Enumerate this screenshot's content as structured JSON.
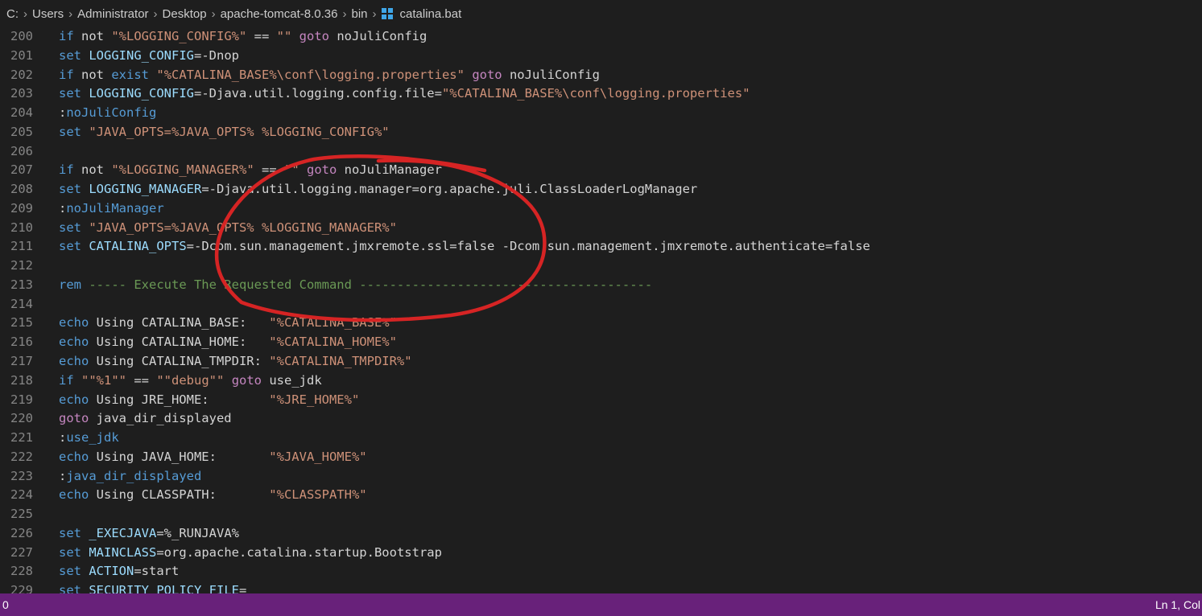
{
  "breadcrumb": {
    "items": [
      "C:",
      "Users",
      "Administrator",
      "Desktop",
      "apache-tomcat-8.0.36",
      "bin"
    ],
    "file": "catalina.bat",
    "file_icon": "windows-file-icon"
  },
  "colors": {
    "background": "#1e1e1e",
    "status_bar": "#68217a",
    "annotation": "#d62424"
  },
  "editor": {
    "lines": [
      {
        "num": "200",
        "tokens": [
          [
            "kw",
            "if"
          ],
          [
            "txt",
            " not "
          ],
          [
            "str",
            "\"%LOGGING_CONFIG%\""
          ],
          [
            "txt",
            " == "
          ],
          [
            "str",
            "\"\""
          ],
          [
            "txt",
            " "
          ],
          [
            "ctl",
            "goto"
          ],
          [
            "txt",
            " noJuliConfig"
          ]
        ]
      },
      {
        "num": "201",
        "tokens": [
          [
            "kw",
            "set"
          ],
          [
            "txt",
            " "
          ],
          [
            "var",
            "LOGGING_CONFIG"
          ],
          [
            "txt",
            "=-Dnop"
          ]
        ]
      },
      {
        "num": "202",
        "tokens": [
          [
            "kw",
            "if"
          ],
          [
            "txt",
            " not "
          ],
          [
            "kw",
            "exist"
          ],
          [
            "txt",
            " "
          ],
          [
            "str",
            "\"%CATALINA_BASE%\\conf\\logging.properties\""
          ],
          [
            "txt",
            " "
          ],
          [
            "ctl",
            "goto"
          ],
          [
            "txt",
            " noJuliConfig"
          ]
        ]
      },
      {
        "num": "203",
        "tokens": [
          [
            "kw",
            "set"
          ],
          [
            "txt",
            " "
          ],
          [
            "var",
            "LOGGING_CONFIG"
          ],
          [
            "txt",
            "=-Djava.util.logging.config.file="
          ],
          [
            "str",
            "\"%CATALINA_BASE%\\conf\\logging.properties\""
          ]
        ]
      },
      {
        "num": "204",
        "tokens": [
          [
            "txt",
            ":"
          ],
          [
            "lbl",
            "noJuliConfig"
          ]
        ]
      },
      {
        "num": "205",
        "tokens": [
          [
            "kw",
            "set"
          ],
          [
            "txt",
            " "
          ],
          [
            "str",
            "\"JAVA_OPTS=%JAVA_OPTS% %LOGGING_CONFIG%\""
          ]
        ]
      },
      {
        "num": "206",
        "tokens": []
      },
      {
        "num": "207",
        "tokens": [
          [
            "kw",
            "if"
          ],
          [
            "txt",
            " not "
          ],
          [
            "str",
            "\"%LOGGING_MANAGER%\""
          ],
          [
            "txt",
            " == "
          ],
          [
            "str",
            "\"\""
          ],
          [
            "txt",
            " "
          ],
          [
            "ctl",
            "goto"
          ],
          [
            "txt",
            " noJuliManager"
          ]
        ]
      },
      {
        "num": "208",
        "tokens": [
          [
            "kw",
            "set"
          ],
          [
            "txt",
            " "
          ],
          [
            "var",
            "LOGGING_MANAGER"
          ],
          [
            "txt",
            "=-Djava.util.logging.manager=org.apache.juli.ClassLoaderLogManager"
          ]
        ]
      },
      {
        "num": "209",
        "tokens": [
          [
            "txt",
            ":"
          ],
          [
            "lbl",
            "noJuliManager"
          ]
        ]
      },
      {
        "num": "210",
        "tokens": [
          [
            "kw",
            "set"
          ],
          [
            "txt",
            " "
          ],
          [
            "str",
            "\"JAVA_OPTS=%JAVA_OPTS% %LOGGING_MANAGER%\""
          ]
        ]
      },
      {
        "num": "211",
        "tokens": [
          [
            "kw",
            "set"
          ],
          [
            "txt",
            " "
          ],
          [
            "var",
            "CATALINA_OPTS"
          ],
          [
            "txt",
            "=-Dcom.sun.management.jmxremote.ssl=false -Dcom.sun.management.jmxremote.authenticate=false"
          ]
        ]
      },
      {
        "num": "212",
        "tokens": []
      },
      {
        "num": "213",
        "tokens": [
          [
            "kw",
            "rem"
          ],
          [
            "cmt",
            " ----- Execute The Requested Command ---------------------------------------"
          ]
        ]
      },
      {
        "num": "214",
        "tokens": []
      },
      {
        "num": "215",
        "tokens": [
          [
            "kw",
            "echo"
          ],
          [
            "txt",
            " Using CATALINA_BASE:   "
          ],
          [
            "str",
            "\"%CATALINA_BASE%\""
          ]
        ]
      },
      {
        "num": "216",
        "tokens": [
          [
            "kw",
            "echo"
          ],
          [
            "txt",
            " Using CATALINA_HOME:   "
          ],
          [
            "str",
            "\"%CATALINA_HOME%\""
          ]
        ]
      },
      {
        "num": "217",
        "tokens": [
          [
            "kw",
            "echo"
          ],
          [
            "txt",
            " Using CATALINA_TMPDIR: "
          ],
          [
            "str",
            "\"%CATALINA_TMPDIR%\""
          ]
        ]
      },
      {
        "num": "218",
        "tokens": [
          [
            "kw",
            "if"
          ],
          [
            "txt",
            " "
          ],
          [
            "str",
            "\"\"%1\"\""
          ],
          [
            "txt",
            " == "
          ],
          [
            "str",
            "\"\"debug\"\""
          ],
          [
            "txt",
            " "
          ],
          [
            "ctl",
            "goto"
          ],
          [
            "txt",
            " use_jdk"
          ]
        ]
      },
      {
        "num": "219",
        "tokens": [
          [
            "kw",
            "echo"
          ],
          [
            "txt",
            " Using JRE_HOME:        "
          ],
          [
            "str",
            "\"%JRE_HOME%\""
          ]
        ]
      },
      {
        "num": "220",
        "tokens": [
          [
            "ctl",
            "goto"
          ],
          [
            "txt",
            " java_dir_displayed"
          ]
        ]
      },
      {
        "num": "221",
        "tokens": [
          [
            "txt",
            ":"
          ],
          [
            "lbl",
            "use_jdk"
          ]
        ]
      },
      {
        "num": "222",
        "tokens": [
          [
            "kw",
            "echo"
          ],
          [
            "txt",
            " Using JAVA_HOME:       "
          ],
          [
            "str",
            "\"%JAVA_HOME%\""
          ]
        ]
      },
      {
        "num": "223",
        "tokens": [
          [
            "txt",
            ":"
          ],
          [
            "lbl",
            "java_dir_displayed"
          ]
        ]
      },
      {
        "num": "224",
        "tokens": [
          [
            "kw",
            "echo"
          ],
          [
            "txt",
            " Using CLASSPATH:       "
          ],
          [
            "str",
            "\"%CLASSPATH%\""
          ]
        ]
      },
      {
        "num": "225",
        "tokens": []
      },
      {
        "num": "226",
        "tokens": [
          [
            "kw",
            "set"
          ],
          [
            "txt",
            " "
          ],
          [
            "var",
            "_EXECJAVA"
          ],
          [
            "txt",
            "=%_RUNJAVA%"
          ]
        ]
      },
      {
        "num": "227",
        "tokens": [
          [
            "kw",
            "set"
          ],
          [
            "txt",
            " "
          ],
          [
            "var",
            "MAINCLASS"
          ],
          [
            "txt",
            "=org.apache.catalina.startup.Bootstrap"
          ]
        ]
      },
      {
        "num": "228",
        "tokens": [
          [
            "kw",
            "set"
          ],
          [
            "txt",
            " "
          ],
          [
            "var",
            "ACTION"
          ],
          [
            "txt",
            "=start"
          ]
        ]
      },
      {
        "num": "229",
        "tokens": [
          [
            "kw",
            "set"
          ],
          [
            "txt",
            " "
          ],
          [
            "var",
            "SECURITY_POLICY_FILE"
          ],
          [
            "txt",
            "="
          ]
        ]
      }
    ]
  },
  "status_bar": {
    "left": "0",
    "right": "Ln 1, Col"
  }
}
